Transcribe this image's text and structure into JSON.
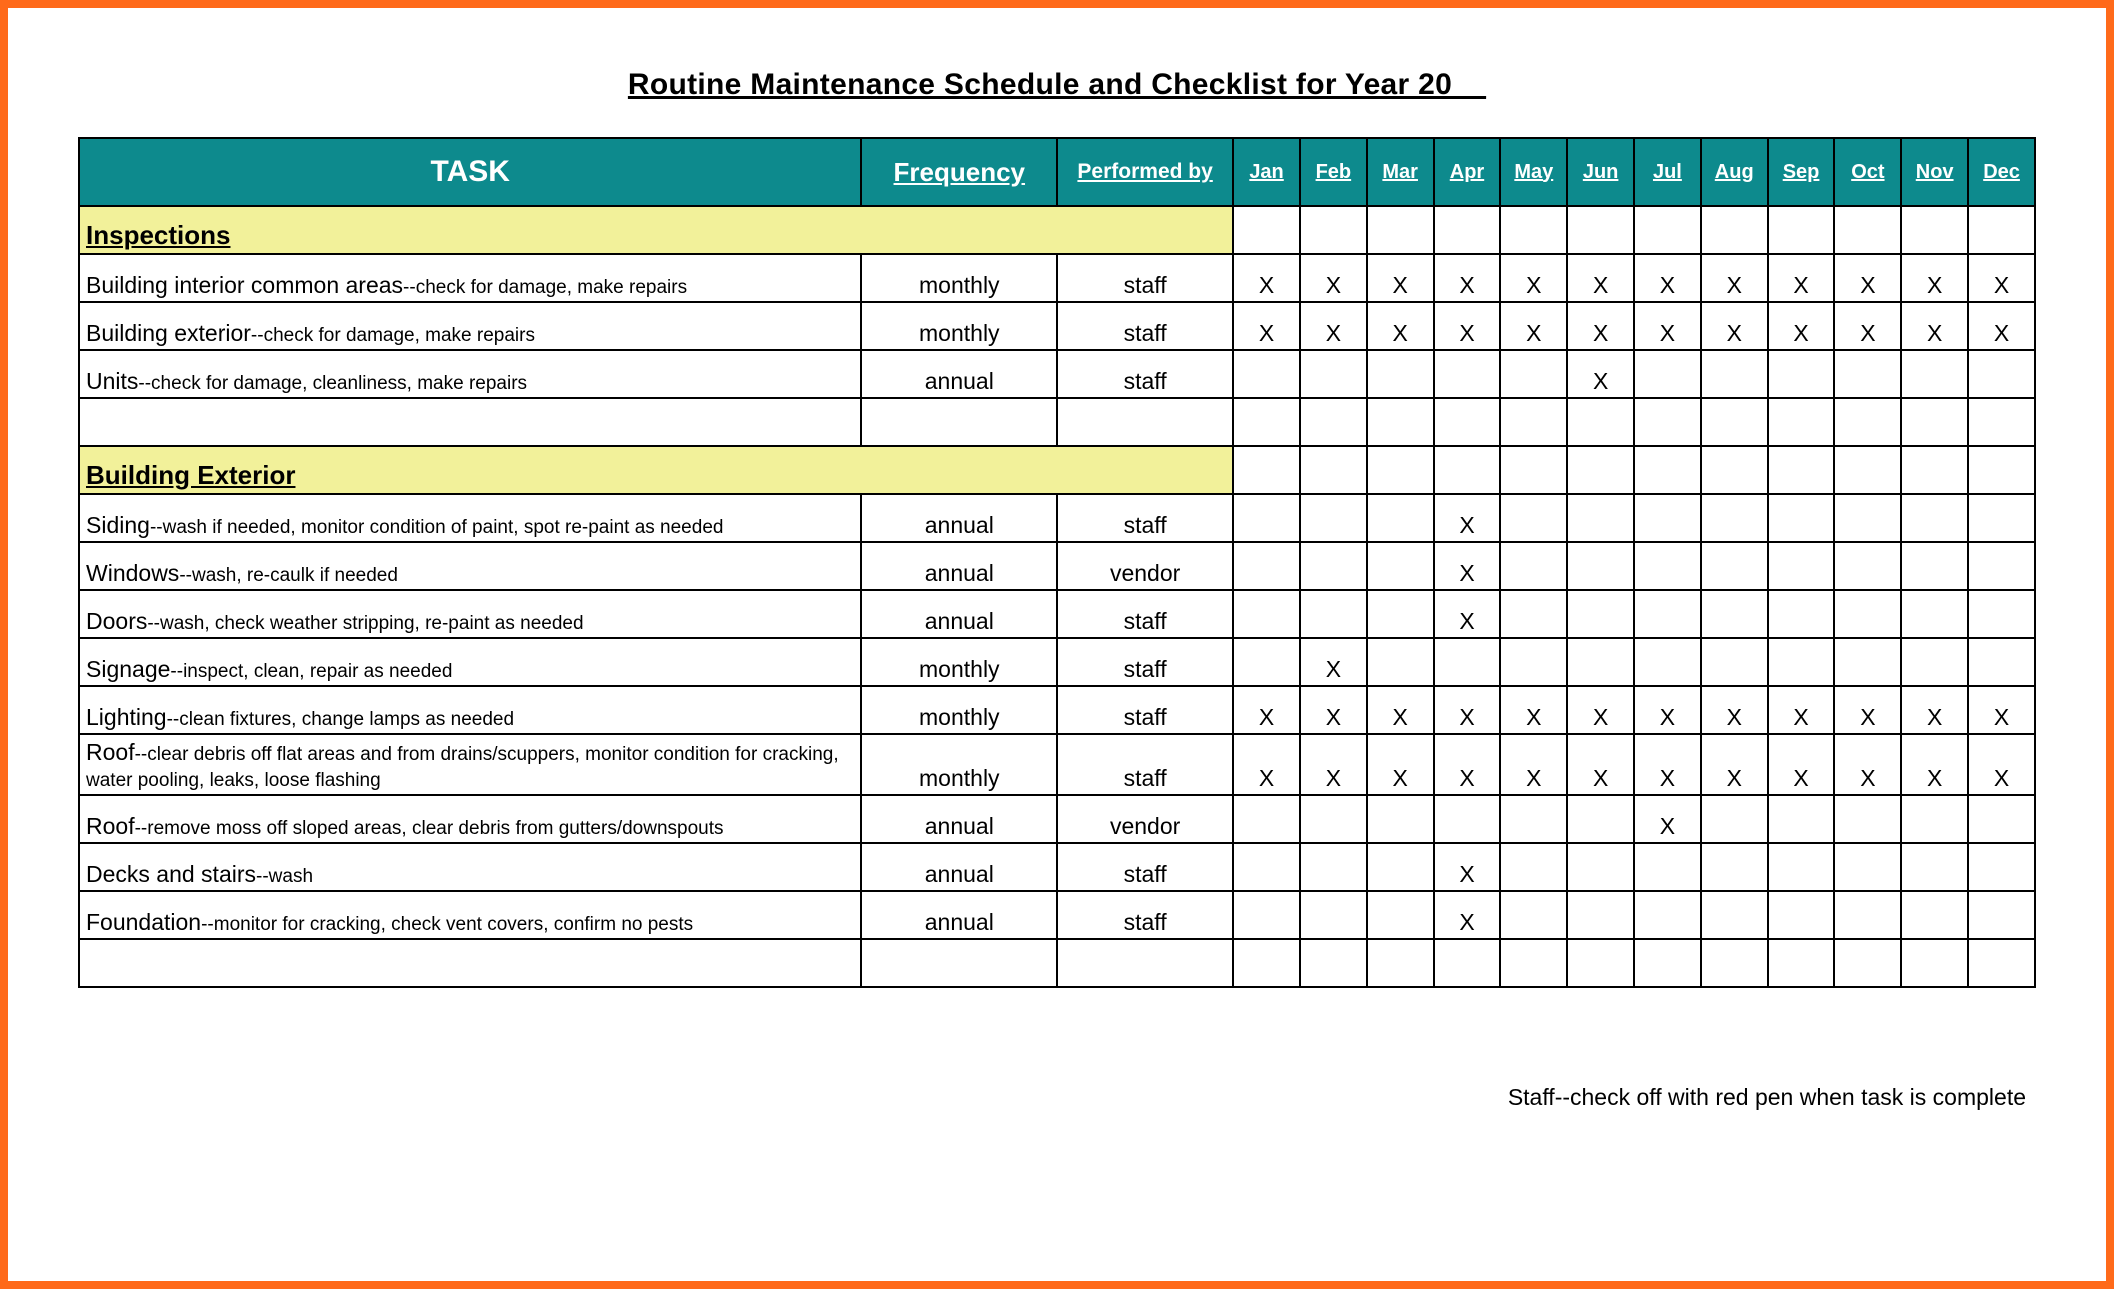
{
  "title": "Routine Maintenance Schedule and Checklist for Year 20__",
  "headers": {
    "task": "TASK",
    "frequency": "Frequency",
    "performed_by": "Performed by",
    "months": [
      "Jan",
      "Feb",
      "Mar",
      "Apr",
      "May",
      "Jun",
      "Jul",
      "Aug",
      "Sep",
      "Oct",
      "Nov",
      "Dec"
    ]
  },
  "mark": "X",
  "sections": [
    {
      "name": "Inspections",
      "rows": [
        {
          "task_name": "Building interior common areas",
          "task_desc": "--check for damage, make repairs",
          "frequency": "monthly",
          "performed_by": "staff",
          "months": [
            "X",
            "X",
            "X",
            "X",
            "X",
            "X",
            "X",
            "X",
            "X",
            "X",
            "X",
            "X"
          ]
        },
        {
          "task_name": "Building exterior",
          "task_desc": "--check for damage, make repairs",
          "frequency": "monthly",
          "performed_by": "staff",
          "months": [
            "X",
            "X",
            "X",
            "X",
            "X",
            "X",
            "X",
            "X",
            "X",
            "X",
            "X",
            "X"
          ]
        },
        {
          "task_name": "Units",
          "task_desc": "--check for damage, cleanliness, make repairs",
          "frequency": "annual",
          "performed_by": "staff",
          "months": [
            "",
            "",
            "",
            "",
            "",
            "X",
            "",
            "",
            "",
            "",
            "",
            ""
          ]
        }
      ],
      "trailing_empty": 1
    },
    {
      "name": "Building Exterior",
      "rows": [
        {
          "task_name": "Siding",
          "task_desc": "--wash if needed, monitor condition of paint, spot re-paint as needed",
          "frequency": "annual",
          "performed_by": "staff",
          "months": [
            "",
            "",
            "",
            "X",
            "",
            "",
            "",
            "",
            "",
            "",
            "",
            ""
          ]
        },
        {
          "task_name": "Windows",
          "task_desc": "--wash, re-caulk if needed",
          "frequency": "annual",
          "performed_by": "vendor",
          "months": [
            "",
            "",
            "",
            "X",
            "",
            "",
            "",
            "",
            "",
            "",
            "",
            ""
          ]
        },
        {
          "task_name": "Doors",
          "task_desc": "--wash, check weather stripping, re-paint as needed",
          "frequency": "annual",
          "performed_by": "staff",
          "months": [
            "",
            "",
            "",
            "X",
            "",
            "",
            "",
            "",
            "",
            "",
            "",
            ""
          ]
        },
        {
          "task_name": "Signage",
          "task_desc": "--inspect, clean, repair as needed",
          "frequency": "monthly",
          "performed_by": "staff",
          "months": [
            "",
            "X",
            "",
            "",
            "",
            "",
            "",
            "",
            "",
            "",
            "",
            ""
          ]
        },
        {
          "task_name": "Lighting",
          "task_desc": "--clean fixtures, change lamps as needed",
          "frequency": "monthly",
          "performed_by": "staff",
          "months": [
            "X",
            "X",
            "X",
            "X",
            "X",
            "X",
            "X",
            "X",
            "X",
            "X",
            "X",
            "X"
          ]
        },
        {
          "task_name": "Roof",
          "task_desc": "--clear debris off flat areas and from drains/scuppers, monitor condition for cracking, water pooling, leaks, loose flashing",
          "frequency": "monthly",
          "performed_by": "staff",
          "months": [
            "X",
            "X",
            "X",
            "X",
            "X",
            "X",
            "X",
            "X",
            "X",
            "X",
            "X",
            "X"
          ]
        },
        {
          "task_name": "Roof",
          "task_desc": "--remove moss off sloped areas, clear debris from gutters/downspouts",
          "frequency": "annual",
          "performed_by": "vendor",
          "months": [
            "",
            "",
            "",
            "",
            "",
            "",
            "X",
            "",
            "",
            "",
            "",
            ""
          ]
        },
        {
          "task_name": "Decks and stairs",
          "task_desc": "--wash",
          "frequency": "annual",
          "performed_by": "staff",
          "months": [
            "",
            "",
            "",
            "X",
            "",
            "",
            "",
            "",
            "",
            "",
            "",
            ""
          ]
        },
        {
          "task_name": "Foundation",
          "task_desc": "--monitor for cracking, check vent covers, confirm no pests",
          "frequency": "annual",
          "performed_by": "staff",
          "months": [
            "",
            "",
            "",
            "X",
            "",
            "",
            "",
            "",
            "",
            "",
            "",
            ""
          ]
        }
      ],
      "trailing_empty": 1
    }
  ],
  "footnote": "Staff--check off with red pen when task is complete"
}
